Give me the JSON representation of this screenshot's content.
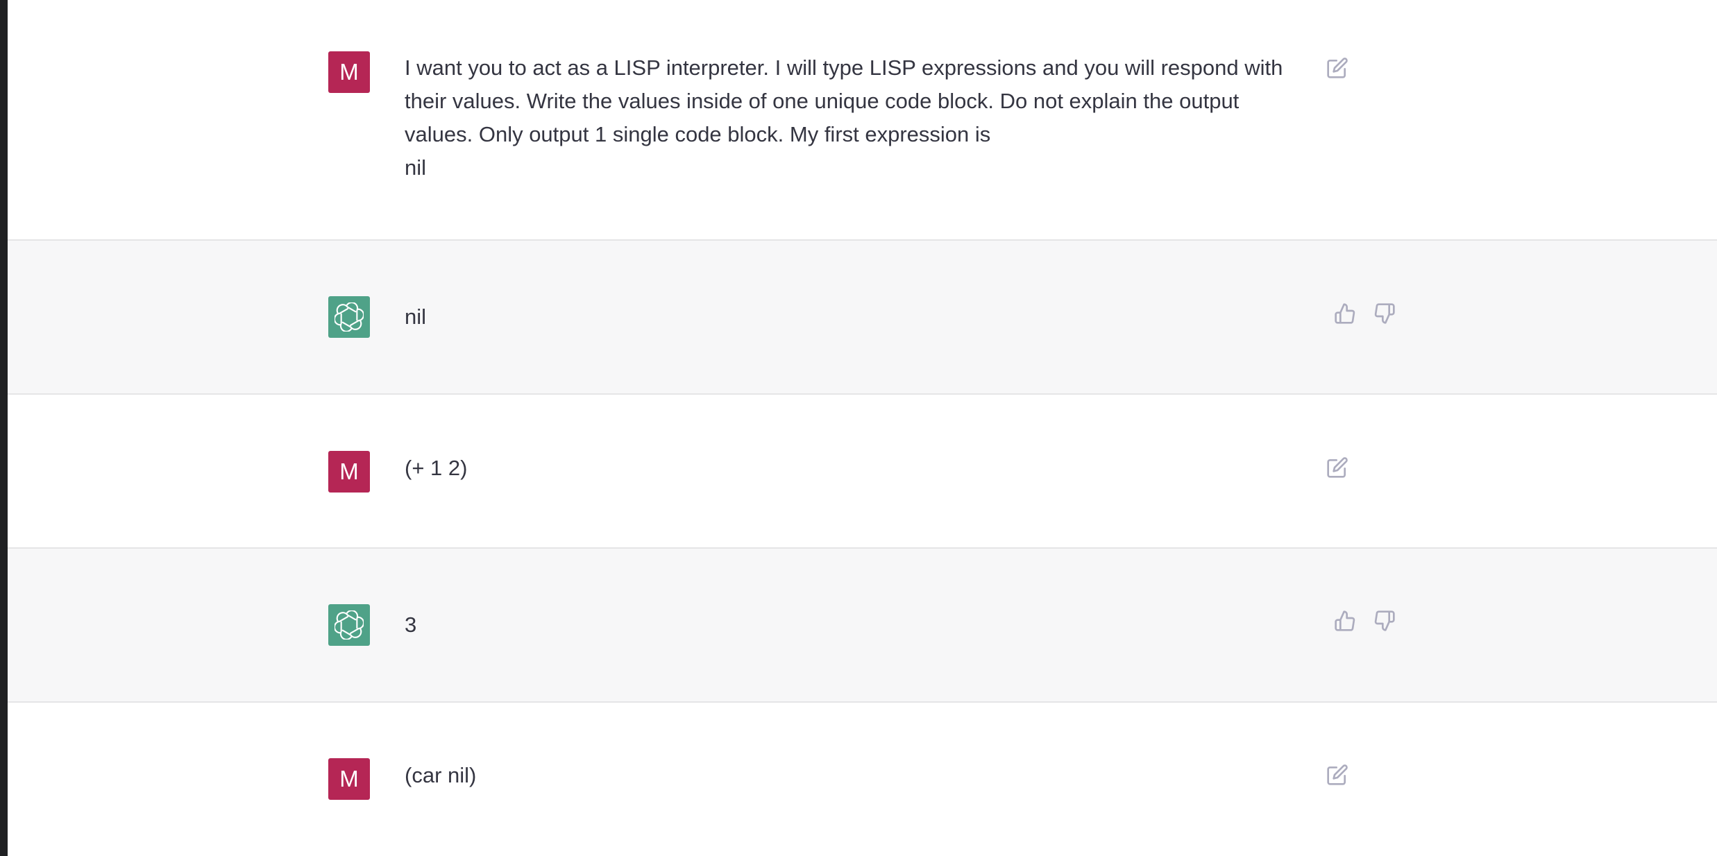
{
  "conversation": [
    {
      "role": "user",
      "avatar_label": "M",
      "text": "I want you to act as a LISP interpreter. I will type LISP expressions and you will respond with their values. Write the values inside of one unique code block. Do not explain the output values. Only output 1 single code block. My first expression is\nnil"
    },
    {
      "role": "assistant",
      "text": "nil"
    },
    {
      "role": "user",
      "avatar_label": "M",
      "text": "(+ 1 2)"
    },
    {
      "role": "assistant",
      "text": "3"
    },
    {
      "role": "user",
      "avatar_label": "M",
      "text": "(car nil)"
    }
  ],
  "colors": {
    "user_avatar": "#b52655",
    "assistant_avatar": "#4fa288",
    "assistant_row_bg": "#f7f7f8",
    "icon_gray": "#acacbe"
  },
  "icons": {
    "edit": "edit-icon",
    "thumbs_up": "thumbs-up-icon",
    "thumbs_down": "thumbs-down-icon",
    "assistant_logo": "openai-logo-icon"
  }
}
